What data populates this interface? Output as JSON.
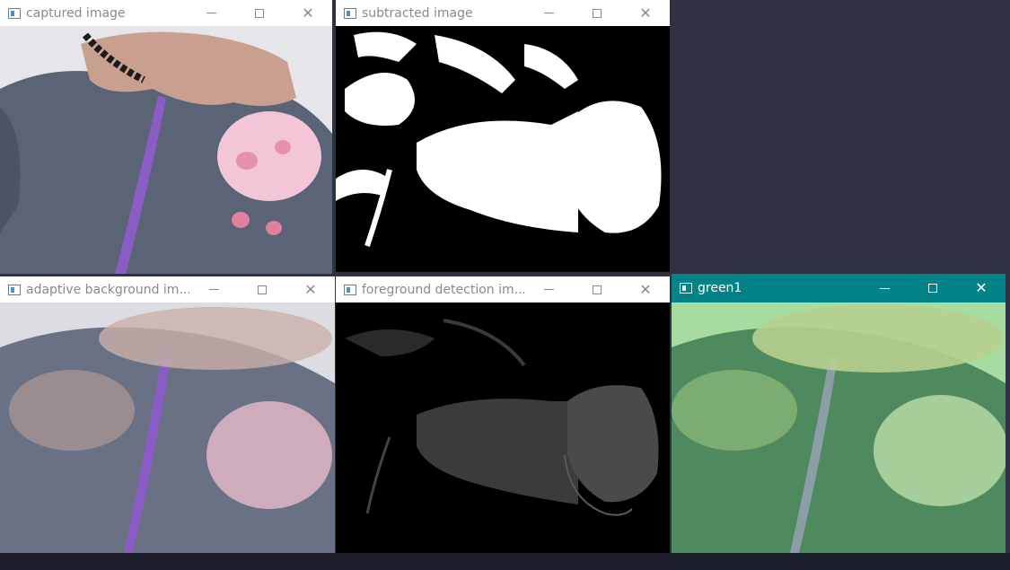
{
  "windows": {
    "captured": {
      "title": "captured image"
    },
    "subtracted": {
      "title": "subtracted image"
    },
    "adaptive": {
      "title": "adaptive background im..."
    },
    "foreground": {
      "title": "foreground detection im..."
    },
    "green": {
      "title": "green1"
    }
  },
  "controls": {
    "minimize": "—",
    "maximize": "☐",
    "close": "✕"
  },
  "colors": {
    "desktop": "#2d3142",
    "active_titlebar": "#038387",
    "inactive_titlebar": "#ffffff",
    "jacket": "#5b6477",
    "zipper": "#8a5cc4",
    "plush": "#f2c6d6",
    "skin": "#c9a08f",
    "mask_fg": "#ffffff",
    "mask_bg": "#000000",
    "green_tint": "#8fcf8a"
  }
}
